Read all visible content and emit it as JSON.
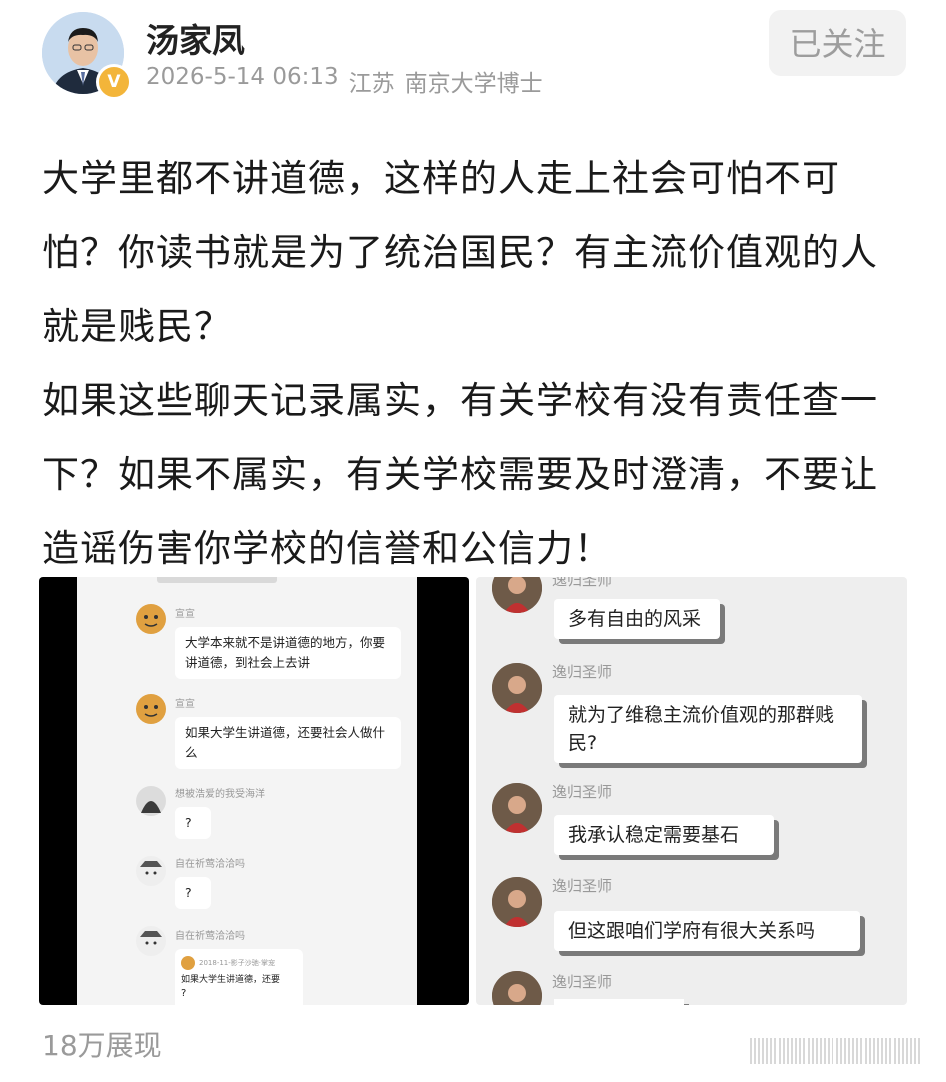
{
  "author": {
    "name": "汤家凤",
    "badge": "V",
    "date": "2026-5-14 06:13",
    "location": "江苏",
    "title": "南京大学博士"
  },
  "follow_label": "已关注",
  "post": {
    "paragraphs": [
      "大学里都不讲道德，这样的人走上社会可怕不可怕？你读书就是为了统治国民？有主流价值观的人就是贱民？",
      "如果这些聊天记录属实，有关学校有没有责任查一下？如果不属实，有关学校需要及时澄清，不要让造谣伤害你学校的信誉和公信力！"
    ]
  },
  "left_image": {
    "messages": [
      {
        "name": "宣宣",
        "text": "大学本来就不是讲道德的地方，你要讲道德，到社会上去讲"
      },
      {
        "name": "宣宣",
        "text": "如果大学生讲道德，还要社会人做什么"
      },
      {
        "name": "想被浩爱的我受海洋",
        "text": "?"
      },
      {
        "name": "自在祈莺洽洽吗",
        "text": "?"
      },
      {
        "name": "自在祈莺洽洽吗",
        "text": "?"
      }
    ],
    "quote": {
      "meta": "2018-11-影子沙驰·掌宠",
      "text": "如果大学生讲道德，还要"
    }
  },
  "right_image": {
    "sender": "逸归圣师",
    "messages": [
      "多有自由的风采",
      "就为了维稳主流价值观的那群贱民?",
      "我承认稳定需要基石",
      "但这跟咱们学府有很大关系吗"
    ]
  },
  "views": "18万展现"
}
